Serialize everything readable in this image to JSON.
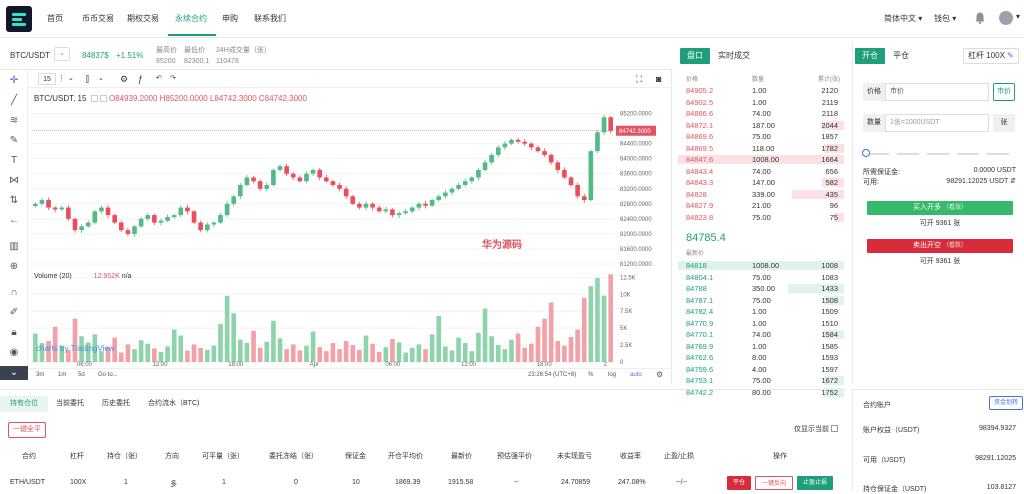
{
  "nav": {
    "items": [
      "首页",
      "币币交易",
      "期权交易",
      "永续合约",
      "申购",
      "联系我们"
    ],
    "active_index": 3,
    "language": "简体中文",
    "wallet": "钱包"
  },
  "ticker": {
    "pair": "BTC/USDT",
    "price": "84837$",
    "change": "+1.51%",
    "high_label": "最高价",
    "high_value": "85200",
    "low_label": "最低价",
    "low_value": "82300.1",
    "vol_label": "24H成交量（张）",
    "vol_value": "110478"
  },
  "chart_toolbar": {
    "interval": "15"
  },
  "chart_legend": {
    "title": "BTC/USDT, 15",
    "open": "O84939.2000",
    "high": "H85200.0000",
    "low": "L84742.3000",
    "close": "C84742.3000",
    "volume_title": "Volume (20)",
    "volume_value": "12.952K",
    "volume_extra": "n/a",
    "watermark": "华为源码",
    "cv_logo": "charts by TradingView"
  },
  "chart_bottom": {
    "ranges": [
      "3m",
      "1m",
      "5d",
      "Go to..."
    ],
    "time": "23:26:54 (UTC+8)",
    "pct": "%",
    "log": "log",
    "auto": "auto"
  },
  "chart_data": {
    "type": "candlestick",
    "title": "BTC/USDT, 15",
    "y_ticks": [
      "85200.0000",
      "84400.0000",
      "84000.0000",
      "83600.0000",
      "83200.0000",
      "82800.0000",
      "82400.0000",
      "82000.0000",
      "81600.0000",
      "81200.0000"
    ],
    "y_last": "84742.3000",
    "ylim": [
      81200,
      85400
    ],
    "x_ticks": [
      "06:00",
      "12:00",
      "18:00",
      "Apr",
      "06:00",
      "12:00",
      "18:00",
      "2"
    ],
    "volume_ticks": [
      "12.5K",
      "10K",
      "7.5K",
      "5K",
      "2.5K",
      "0"
    ],
    "volume_ylim": [
      0,
      13000
    ],
    "close": [
      82800,
      82900,
      82700,
      82650,
      82700,
      82400,
      82100,
      82200,
      82300,
      82600,
      82700,
      82500,
      82300,
      82100,
      82000,
      82200,
      82400,
      82500,
      82300,
      82350,
      82450,
      82500,
      82700,
      82600,
      82300,
      82100,
      82250,
      82300,
      82500,
      82800,
      83000,
      83300,
      83500,
      83400,
      83200,
      83300,
      83700,
      83800,
      83600,
      83500,
      83400,
      83600,
      83700,
      83500,
      83400,
      83300,
      83200,
      83000,
      82800,
      82700,
      82800,
      82700,
      82600,
      82650,
      82500,
      82550,
      82600,
      82700,
      82800,
      82750,
      82900,
      83000,
      83100,
      83200,
      83300,
      83400,
      83500,
      83700,
      83900,
      84100,
      84300,
      84400,
      84500,
      84450,
      84400,
      84300,
      84200,
      84100,
      83900,
      83700,
      83500,
      83300,
      83000,
      82900,
      84200,
      84700,
      85100,
      84742
    ],
    "volume": [
      4200,
      2800,
      3100,
      5200,
      2400,
      1800,
      6400,
      3800,
      2900,
      4100,
      1600,
      2200,
      3600,
      1400,
      2600,
      1900,
      3200,
      2700,
      2000,
      1500,
      2300,
      4800,
      3900,
      1700,
      2600,
      2100,
      1800,
      2400,
      5600,
      9800,
      7200,
      3300,
      2800,
      4600,
      2100,
      3000,
      6100,
      3500,
      1900,
      2600,
      1700,
      2400,
      4500,
      2200,
      1600,
      2800,
      1900,
      3100,
      2500,
      1800,
      3900,
      2700,
      1500,
      2200,
      3400,
      2900,
      1400,
      2100,
      2600,
      1900,
      4100,
      6800,
      2300,
      1700,
      3600,
      2800,
      1600,
      4300,
      7900,
      3800,
      2500,
      1900,
      3300,
      4200,
      2100,
      2700,
      5200,
      6400,
      8800,
      3100,
      2400,
      3700,
      4800,
      9500,
      11200,
      12400,
      9800,
      12952
    ]
  },
  "order_book": {
    "tabs": [
      "盘口",
      "实时成交"
    ],
    "head": [
      "价格",
      "数量",
      "累计(张)"
    ],
    "asks": [
      {
        "p": "84905.2",
        "a": "1.00",
        "s": "2120",
        "d": 0
      },
      {
        "p": "84902.5",
        "a": "1.00",
        "s": "2119",
        "d": 0
      },
      {
        "p": "84886.6",
        "a": "74.00",
        "s": "2118",
        "d": 0
      },
      {
        "p": "84872.1",
        "a": "187.00",
        "s": "2044",
        "d": 22
      },
      {
        "p": "84869.6",
        "a": "75.00",
        "s": "1857",
        "d": 0
      },
      {
        "p": "84869.5",
        "a": "118.00",
        "s": "1782",
        "d": 20
      },
      {
        "p": "84847.6",
        "a": "1008.00",
        "s": "1664",
        "d": 166
      },
      {
        "p": "84843.4",
        "a": "74.00",
        "s": "656",
        "d": 0
      },
      {
        "p": "84843.3",
        "a": "147.00",
        "s": "582",
        "d": 22
      },
      {
        "p": "84828",
        "a": "339.00",
        "s": "435",
        "d": 52
      },
      {
        "p": "84827.9",
        "a": "21.00",
        "s": "96",
        "d": 0
      },
      {
        "p": "84823.8",
        "a": "75.00",
        "s": "75",
        "d": 10
      }
    ],
    "mid_price": "84785.4",
    "latest_label": "最新价",
    "bids": [
      {
        "p": "84818",
        "a": "1008.00",
        "s": "1008",
        "d": 166
      },
      {
        "p": "84804.1",
        "a": "75.00",
        "s": "1083",
        "d": 0
      },
      {
        "p": "84788",
        "a": "350.00",
        "s": "1433",
        "d": 56
      },
      {
        "p": "84787.1",
        "a": "75.00",
        "s": "1508",
        "d": 20
      },
      {
        "p": "84782.4",
        "a": "1.00",
        "s": "1509",
        "d": 0
      },
      {
        "p": "84770.9",
        "a": "1.00",
        "s": "1510",
        "d": 0
      },
      {
        "p": "84770.1",
        "a": "74.00",
        "s": "1584",
        "d": 20
      },
      {
        "p": "84769.9",
        "a": "1.00",
        "s": "1585",
        "d": 0
      },
      {
        "p": "84762.6",
        "a": "8.00",
        "s": "1593",
        "d": 0
      },
      {
        "p": "84759.6",
        "a": "4.00",
        "s": "1597",
        "d": 0
      },
      {
        "p": "84753.1",
        "a": "75.00",
        "s": "1672",
        "d": 20
      },
      {
        "p": "84742.2",
        "a": "80.00",
        "s": "1752",
        "d": 20
      }
    ]
  },
  "form": {
    "tab_open": "开仓",
    "tab_close": "平仓",
    "leverage": "杠杆 100X",
    "price_label": "价格",
    "price_value": "市价",
    "market_btn": "市价",
    "qty_label": "数量",
    "qty_placeholder": "1张=1000USDT",
    "qty_unit": "张",
    "margin_label": "所需保证金:",
    "margin_value": "0.0000 USDT",
    "avail_label": "可用:",
    "avail_value": "98291.12025 USDT",
    "buy_label": "买入开多",
    "buy_sub": "（看涨）",
    "buy_avail": "可开 9361 张",
    "sell_label": "卖出开空",
    "sell_sub": "（看跌）",
    "sell_avail": "可开 9361 张"
  },
  "positions": {
    "tabs": [
      "持有仓位",
      "当前委托",
      "历史委托",
      "合约流水（BTC)"
    ],
    "close_all": "一键全平",
    "show_current": "仅显示当前",
    "headers": [
      "合约",
      "杠杆",
      "持仓（张）",
      "方向",
      "可平量（张）",
      "委托冻结（张）",
      "保证金",
      "开仓平均价",
      "最新价",
      "预估强平价",
      "未实现盈亏",
      "收益率",
      "止盈/止损",
      "操作"
    ],
    "row": [
      "ETH/USDT",
      "100X",
      "1",
      "多",
      "1",
      "0",
      "10",
      "1869.39",
      "1915.58",
      "--",
      "24.70859",
      "247.08%",
      "--/--"
    ],
    "actions": [
      "平仓",
      "一键反向",
      "止盈止损"
    ]
  },
  "account": {
    "title": "合约账户",
    "transfer": "资金划转",
    "equity_label": "账户权益（USDT)",
    "equity_value": "98394.9327",
    "avail_label": "可用（USDT)",
    "avail_value": "98291.12025",
    "margin_label": "持仓保证金（USDT)",
    "margin_value": "103.8127"
  },
  "colors": {
    "green": "#1e9e7a",
    "red": "#e05563",
    "buy": "#36b96a",
    "sell": "#d82c3c"
  }
}
